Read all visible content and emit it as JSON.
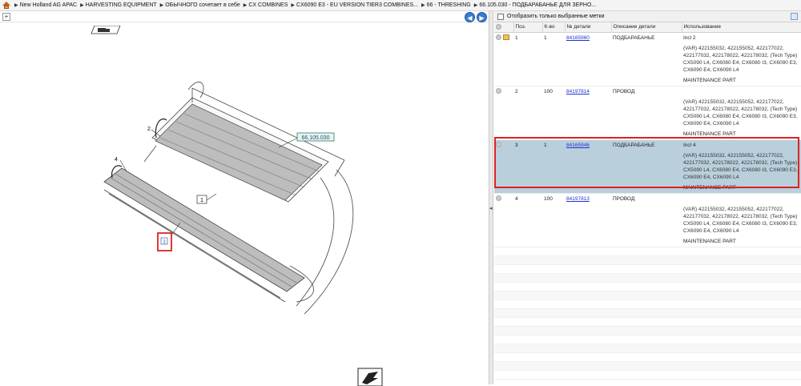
{
  "breadcrumb": [
    "New Holland AG APAC",
    "HARVESTING EQUIPMENT",
    "ОБЫЧНОГО сочетает в себе",
    "CX COMBINES",
    "CX6090 E3 - EU VERSION TIER3 COMBINES...",
    "66 - THRESHING",
    "66.105.030 - ПОДБАРАБАНЬЕ ДЛЯ ЗЕРНО..."
  ],
  "diagram": {
    "callout_ref": "66.105.030",
    "labels": [
      "1",
      "2",
      "4",
      "3"
    ]
  },
  "filter": {
    "label": "Отобразить только выбранные метки"
  },
  "table": {
    "headers": [
      "Поз.",
      "К-во",
      "№ детали",
      "Описание детали",
      "Использование"
    ],
    "rows": [
      {
        "pos": "1",
        "qty": "1",
        "part": "84165960",
        "desc": "ПОДБАРАБАНЬЕ",
        "usage": "Incl 2",
        "note": "(VAR) 422155032, 422155052, 422177022, 422177032, 422178022, 422178032, (Tech Type) CX5090 L4, CX6080 E4, CX6080 I3, CX6090 E3, CX6090 E4, CX6090 L4",
        "maint": "MAINTENANCE PART"
      },
      {
        "pos": "2",
        "qty": "100",
        "part": "84197814",
        "desc": "ПРОВОД",
        "usage": "",
        "note": "(VAR) 422155032, 422155052, 422177022, 422177032, 422178022, 422178032, (Tech Type) CX5090 L4, CX6080 E4, CX6080 I3, CX6090 E3, CX6090 E4, CX6090 L4",
        "maint": "MAINTENANCE PART"
      },
      {
        "pos": "3",
        "qty": "1",
        "part": "84165946",
        "desc": "ПОДБАРАБАНЬЕ",
        "usage": "Incl 4",
        "note": "(VAR) 422155032, 422155052, 422177022, 422177032, 422178022, 422178032, (Tech Type) CX5090 L4, CX6080 E4, CX6080 I3, CX6090 E3, CX6090 E4, CX6090 L4",
        "maint": "MAINTENANCE PART"
      },
      {
        "pos": "4",
        "qty": "100",
        "part": "84197813",
        "desc": "ПРОВОД",
        "usage": "",
        "note": "(VAR) 422155032, 422155052, 422177022, 422177032, 422178022, 422178032, (Tech Type) CX5090 L4, CX6080 E4, CX6080 I3, CX6090 E3, CX6090 E4, CX6090 L4",
        "maint": "MAINTENANCE PART"
      }
    ]
  },
  "colors": {
    "selected_row": "#b9cfdc",
    "highlight_border": "#e02020",
    "link": "#2233cc"
  }
}
